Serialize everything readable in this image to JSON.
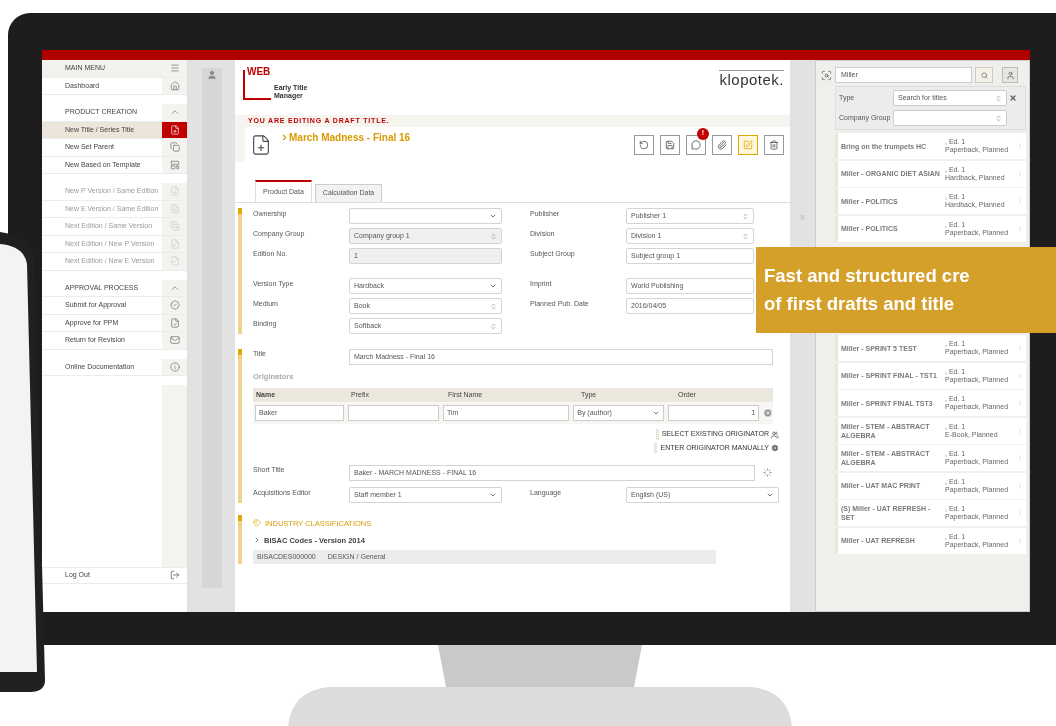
{
  "sidebar": {
    "groups": [
      [
        {
          "kind": "header",
          "label": "MAIN MENU",
          "selected": false,
          "disabled": false
        },
        {
          "kind": "item",
          "label": "Dashboard",
          "selected": false,
          "disabled": false
        }
      ],
      [
        {
          "kind": "section",
          "label": "PRODUCT CREATION",
          "expanded": true,
          "selected": false,
          "disabled": false
        },
        {
          "kind": "item",
          "label": "New Title / Series Title",
          "selected": true,
          "disabled": false
        },
        {
          "kind": "item",
          "label": "New Set Parent",
          "selected": false,
          "disabled": false
        },
        {
          "kind": "item",
          "label": "New Based on Template",
          "selected": false,
          "disabled": false
        }
      ],
      [
        {
          "kind": "item",
          "label": "New P Version / Same Edition",
          "selected": false,
          "disabled": true
        },
        {
          "kind": "item",
          "label": "New E Version / Same Edition",
          "selected": false,
          "disabled": true
        },
        {
          "kind": "item",
          "label": "Next Edition / Same Version",
          "selected": false,
          "disabled": true
        },
        {
          "kind": "item",
          "label": "Next Edition / New P Version",
          "selected": false,
          "disabled": true
        },
        {
          "kind": "item",
          "label": "Next Edition / New E Version",
          "selected": false,
          "disabled": true
        }
      ],
      [
        {
          "kind": "section",
          "label": "APPROVAL PROCESS",
          "expanded": true,
          "selected": false,
          "disabled": false
        },
        {
          "kind": "item",
          "label": "Submit for Approval",
          "selected": false,
          "disabled": false
        },
        {
          "kind": "item",
          "label": "Approve for PPM",
          "selected": false,
          "disabled": false
        },
        {
          "kind": "item",
          "label": "Return for Revision",
          "selected": false,
          "disabled": false
        }
      ],
      [
        {
          "kind": "item",
          "label": "Online Documentation",
          "selected": false,
          "disabled": false
        }
      ]
    ],
    "log_out": "Log Out"
  },
  "header": {
    "logo": "WEB",
    "app_name": "Early Title Manager",
    "brand": "klopotek."
  },
  "notice": "YOU ARE EDITING A DRAFT TITLE.",
  "record_title": "March Madness - Final 16",
  "toolbar": [
    {
      "selected": false
    },
    {
      "selected": false
    },
    {
      "selected": false,
      "badge": "!"
    },
    {
      "selected": false
    },
    {
      "selected": true
    },
    {
      "selected": false
    }
  ],
  "tabs": [
    {
      "label": "Product Data",
      "selected": true
    },
    {
      "label": "Calculation Data",
      "selected": false
    }
  ],
  "form_groups": [
    [
      {
        "left": {
          "label": "Ownership",
          "kind": "dropdown",
          "disabled": false
        },
        "right": {
          "label": "Publisher",
          "value": "Publisher 1",
          "kind": "spinner",
          "disabled": false
        }
      },
      {
        "left": {
          "label": "Company Group",
          "value": "Company group 1",
          "kind": "spinner",
          "disabled": true
        },
        "right": {
          "label": "Division",
          "value": "Division 1",
          "kind": "spinner",
          "disabled": false
        }
      },
      {
        "left": {
          "label": "Edition No.",
          "value": "1",
          "kind": "text",
          "disabled": true
        },
        "right": {
          "label": "Subject Group",
          "value": "Subject group 1",
          "kind": "text",
          "disabled": false
        }
      }
    ],
    [
      {
        "left": {
          "label": "Version Type",
          "value": "Hardback",
          "kind": "dropdown",
          "disabled": false
        },
        "right": {
          "label": "Imprint",
          "value": "World Publishing",
          "kind": "text",
          "disabled": false
        }
      },
      {
        "left": {
          "label": "Medium",
          "value": "Book",
          "kind": "spinner",
          "disabled": false
        },
        "right": {
          "label": "Planned Pub. Date",
          "value": "2016/04/05",
          "kind": "text",
          "disabled": false
        }
      },
      {
        "left": {
          "label": "Binding",
          "value": "Softback",
          "kind": "spinner",
          "disabled": false
        }
      }
    ]
  ],
  "title_field": {
    "label": "Title",
    "value": "March Madness - Final 16"
  },
  "originators": {
    "label": "Originators",
    "columns": [
      "Name",
      "Prefix",
      "First Name",
      "Type",
      "Order"
    ],
    "rows": [
      [
        "Baker",
        "",
        "Tim",
        "By (author)",
        "1"
      ]
    ],
    "links": [
      "SELECT EXISTING ORIGINATOR",
      "ENTER ORIGINATOR MANUALLY"
    ]
  },
  "short_title": {
    "label": "Short Title",
    "value": "Baker - MARCH MADNESS - FINAL 16"
  },
  "bottom_row": {
    "left": {
      "label": "Acquisitions Editor",
      "value": "Staff member 1",
      "kind": "dropdown",
      "disabled": false
    },
    "right": {
      "label": "Language",
      "value": "English (US)",
      "kind": "dropdown",
      "disabled": false
    }
  },
  "industry": {
    "heading": "INDUSTRY CLASSIFICATIONS",
    "subheading": "BISAC Codes - Version 2014",
    "row": [
      "BISACDES000000",
      "DESIGN / General"
    ]
  },
  "search_panel": {
    "query": "Miller",
    "filters": [
      {
        "label": "Type",
        "value": "Search for titles"
      },
      {
        "label": "Company Group"
      }
    ],
    "result_groups": [
      [
        {
          "title": "Bring on the trumpets HC",
          "edition": ", Ed. 1",
          "format": "Paperback, Planned"
        },
        {
          "title": "Miller - ORGANIC DIET ASIAN",
          "edition": ", Ed. 1",
          "format": "Hardback, Planned"
        },
        {
          "title": "Miller - POLITICS",
          "edition": ", Ed. 1",
          "format": "Hardback, Planned"
        },
        {
          "title": "Miller - POLITICS",
          "edition": ", Ed. 1",
          "format": "Paperback, Planned"
        }
      ],
      [
        {
          "title": "Miller - SPRINT 5 TEST",
          "edition": ", Ed. 1",
          "format": "Paperback, Planned"
        },
        {
          "title": "Miller - SPRINT FINAL - TST1",
          "edition": ", Ed. 1",
          "format": "Paperback, Planned"
        },
        {
          "title": "Miller - SPRINT FINAL TST3",
          "edition": ", Ed. 1",
          "format": "Paperback, Planned"
        },
        {
          "title": "Miller - STEM - ABSTRACT ALGEBRA",
          "edition": ", Ed. 1",
          "format": "E-Book, Planned"
        },
        {
          "title": "Miller - STEM - ABSTRACT ALGEBRA",
          "edition": ", Ed. 1",
          "format": "Paperback, Planned"
        },
        {
          "title": "Miller - UAT MAC PRINT",
          "edition": ", Ed. 1",
          "format": "Paperback, Planned"
        },
        {
          "title": "(S) Miller - UAT REFRESH - SET",
          "edition": ", Ed. 1",
          "format": "Paperback, Planned"
        },
        {
          "title": "Miller - UAT REFRESH",
          "edition": ", Ed. 1",
          "format": "Paperback, Planned"
        }
      ]
    ]
  },
  "banner": [
    "Fast and structured cre",
    "of first drafts and title"
  ]
}
